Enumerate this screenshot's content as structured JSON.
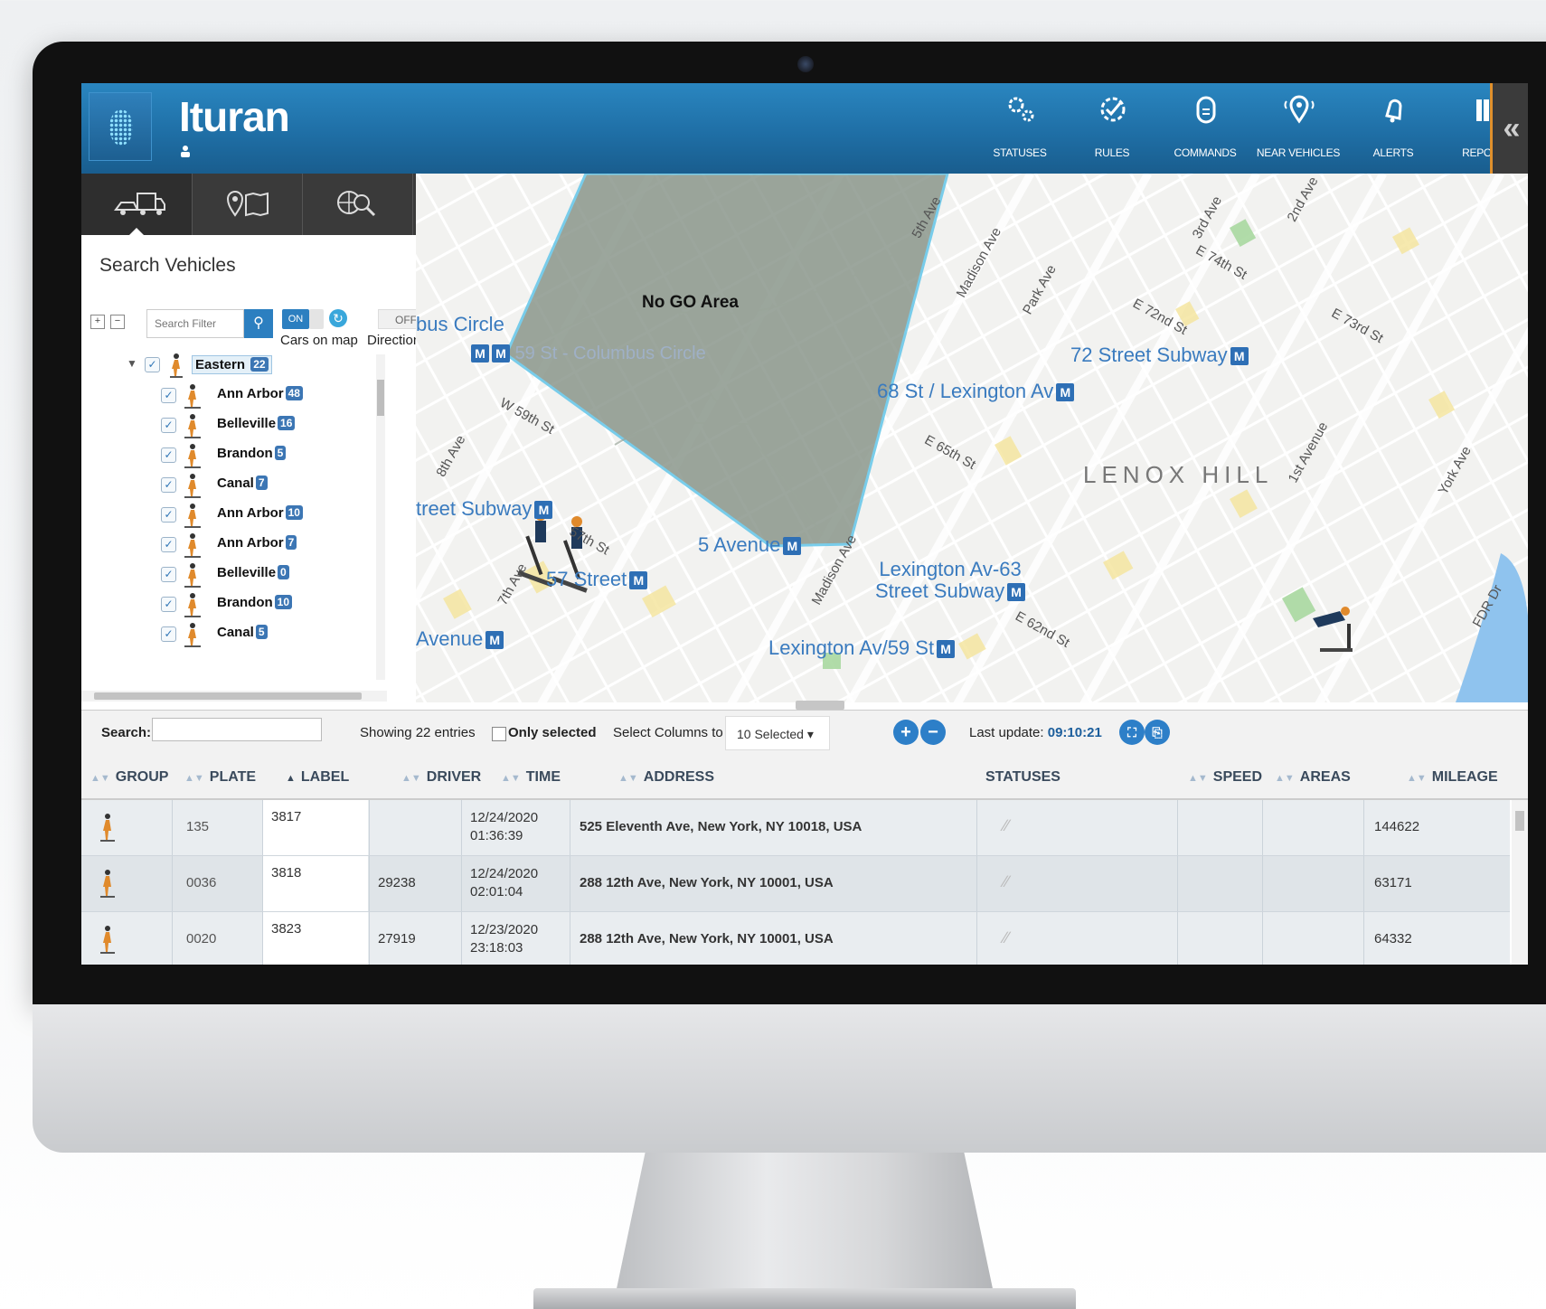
{
  "app": {
    "title": "Ituran",
    "nav": [
      {
        "label": "STATUSES",
        "icon": "gears-icon"
      },
      {
        "label": "RULES",
        "icon": "rules-icon"
      },
      {
        "label": "COMMANDS",
        "icon": "commands-icon"
      },
      {
        "label": "NEAR VEHICLES",
        "icon": "near-vehicles-icon"
      },
      {
        "label": "ALERTS",
        "icon": "alerts-icon"
      },
      {
        "label": "REPORTS",
        "icon": "reports-icon"
      }
    ],
    "collapse_glyph": "«"
  },
  "left_panel": {
    "tabs": [
      "vehicles-tab-icon",
      "locations-tab-icon",
      "search-map-tab-icon"
    ],
    "title": "Search Vehicles",
    "search_placeholder": "Search Filter",
    "toggle_on": "ON",
    "toggle_off": "OFF",
    "cars_on_map_label": "Cars on map",
    "direction_label": "Direction",
    "tree": {
      "root": {
        "name": "Eastern",
        "count": "22"
      },
      "children": [
        {
          "name": "Ann Arbor",
          "count": "48"
        },
        {
          "name": "Belleville",
          "count": "16"
        },
        {
          "name": "Brandon",
          "count": "5"
        },
        {
          "name": "Canal",
          "count": "7"
        },
        {
          "name": "Ann Arbor",
          "count": "10"
        },
        {
          "name": "Ann Arbor",
          "count": "7"
        },
        {
          "name": "Belleville",
          "count": "0"
        },
        {
          "name": "Brandon",
          "count": "10"
        },
        {
          "name": "Canal",
          "count": "5"
        }
      ]
    }
  },
  "map": {
    "no_go_area": "No GO Area",
    "labels": [
      "72 Street Subway",
      "68 St / Lexington Av",
      "59 St - Columbus Circle",
      "bus Circle",
      "treet Subway",
      "5 Avenue",
      "57 Street",
      "Lexington Av-63",
      "Street Subway",
      "Lexington Av/59 St",
      "Avenue",
      "LENOX HILL"
    ],
    "streets": [
      "5th Ave",
      "Madison Ave",
      "Park Ave",
      "3rd Ave",
      "E 72nd St",
      "E 65th St",
      "57th St",
      "8th Ave",
      "7th Ave",
      "Madison Ave",
      "E 62nd St",
      "1st Avenue",
      "York Ave",
      "2nd Ave",
      "FDR Dr",
      "W 59th St",
      "E 74th St",
      "E 73rd St"
    ]
  },
  "grid_toolbar": {
    "search_label": "Search:",
    "showing": "Showing 22 entries",
    "only_selected": "Only selected",
    "select_columns_label": "Select Columns to view:",
    "select_columns_value": "10 Selected",
    "last_update_label": "Last update:",
    "last_update_value": "09:10:21"
  },
  "grid": {
    "columns": [
      "GROUP",
      "PLATE",
      "LABEL",
      "DRIVER",
      "TIME",
      "ADDRESS",
      "STATUSES",
      "SPEED",
      "AREAS",
      "MILEAGE"
    ],
    "rows": [
      {
        "plate": "135",
        "label": "3817",
        "driver": "",
        "time1": "12/24/2020",
        "time2": "01:36:39",
        "address": "525 Eleventh Ave, New York, NY 10018, USA",
        "mileage": "144622"
      },
      {
        "plate": "0036",
        "label": "3818",
        "driver": "29238",
        "time1": "12/24/2020",
        "time2": "02:01:04",
        "address": "288 12th Ave, New York, NY 10001, USA",
        "mileage": "63171"
      },
      {
        "plate": "0020",
        "label": "3823",
        "driver": "27919",
        "time1": "12/23/2020",
        "time2": "23:18:03",
        "address": "288 12th Ave, New York, NY 10001, USA",
        "mileage": "64332"
      }
    ]
  },
  "colors": {
    "header_blue": "#1f6fa6",
    "accent": "#2c7fc0",
    "no_go_fill": "#7d8a7e"
  }
}
